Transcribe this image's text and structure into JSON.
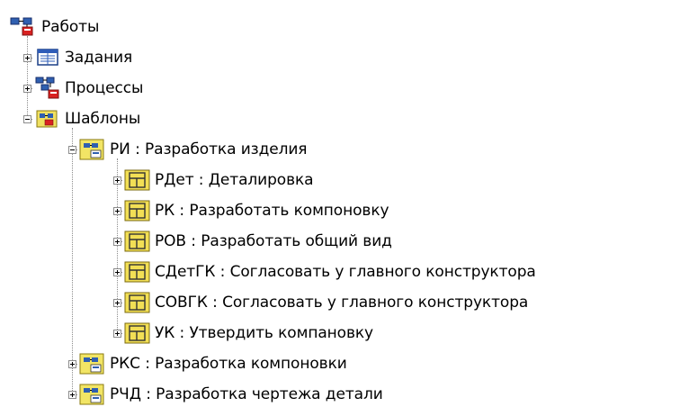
{
  "tree": {
    "root": {
      "label": "Работы",
      "icon": "workflow-root-icon"
    },
    "items": [
      {
        "label": "Задания",
        "icon": "tasks-window-icon",
        "state": "collapsed"
      },
      {
        "label": "Процессы",
        "icon": "processes-icon",
        "state": "collapsed"
      },
      {
        "label": "Шаблоны",
        "icon": "templates-folder-icon",
        "state": "expanded",
        "children": [
          {
            "label": "РИ : Разработка изделия",
            "icon": "workflow-template-icon",
            "state": "expanded",
            "children": [
              {
                "label": "РДет : Деталировка",
                "icon": "task-template-icon",
                "state": "collapsed"
              },
              {
                "label": "РК : Разработать компоновку",
                "icon": "task-template-icon",
                "state": "collapsed"
              },
              {
                "label": "РОВ : Разработать общий вид",
                "icon": "task-template-icon",
                "state": "collapsed"
              },
              {
                "label": "СДетГК : Согласовать у главного конструктора",
                "icon": "task-template-icon",
                "state": "collapsed"
              },
              {
                "label": "СОВГК : Согласовать у главного конструктора",
                "icon": "task-template-icon",
                "state": "collapsed"
              },
              {
                "label": "УК : Утвердить компановку",
                "icon": "task-template-icon",
                "state": "collapsed"
              }
            ]
          },
          {
            "label": "РКС : Разработка компоновки",
            "icon": "workflow-template-icon",
            "state": "collapsed"
          },
          {
            "label": "РЧД : Разработка чертежа детали",
            "icon": "workflow-template-icon",
            "state": "collapsed"
          }
        ]
      }
    ]
  }
}
